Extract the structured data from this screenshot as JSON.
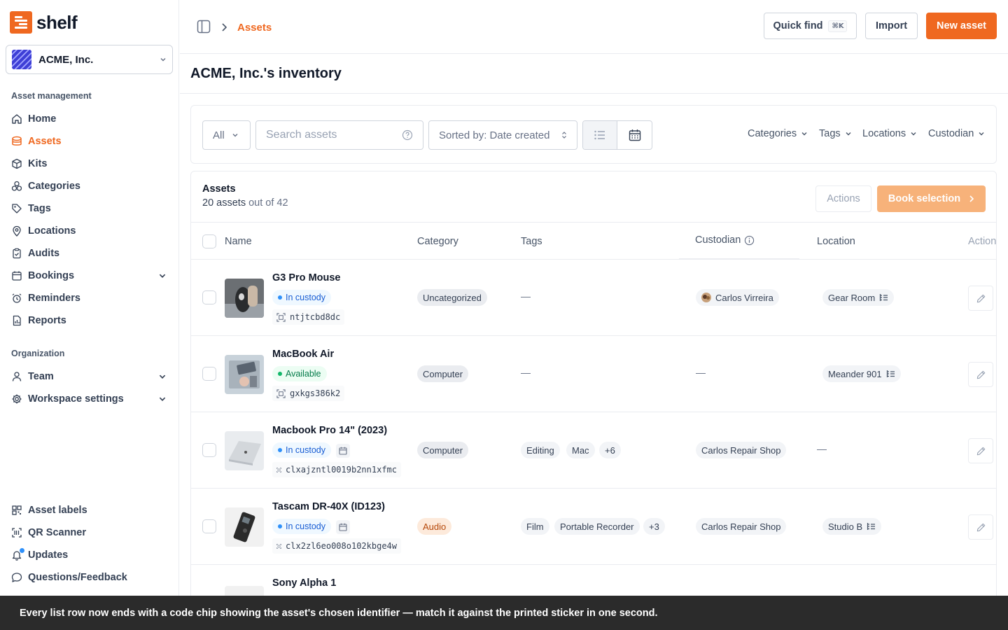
{
  "app": {
    "name": "shelf",
    "brand_color": "#ef6820"
  },
  "workspace": {
    "name": "ACME, Inc."
  },
  "sidebar": {
    "asset_section": "Asset management",
    "asset_items": [
      {
        "label": "Home",
        "icon": "home-icon"
      },
      {
        "label": "Assets",
        "icon": "assets-icon",
        "active": true
      },
      {
        "label": "Kits",
        "icon": "kits-icon"
      },
      {
        "label": "Categories",
        "icon": "categories-icon"
      },
      {
        "label": "Tags",
        "icon": "tag-icon"
      },
      {
        "label": "Locations",
        "icon": "location-pin-icon"
      },
      {
        "label": "Audits",
        "icon": "clipboard-icon"
      },
      {
        "label": "Bookings",
        "icon": "calendar-icon"
      },
      {
        "label": "Reminders",
        "icon": "alarm-icon"
      },
      {
        "label": "Reports",
        "icon": "report-icon"
      }
    ],
    "org_section": "Organization",
    "org_items": [
      {
        "label": "Team",
        "icon": "user-icon"
      },
      {
        "label": "Workspace settings",
        "icon": "gear-icon"
      }
    ],
    "bottom_items": [
      {
        "label": "Asset labels",
        "icon": "qr-icon"
      },
      {
        "label": "QR Scanner",
        "icon": "scanner-icon"
      },
      {
        "label": "Updates",
        "icon": "bell-icon"
      },
      {
        "label": "Questions/Feedback",
        "icon": "chat-icon"
      }
    ]
  },
  "header": {
    "breadcrumb": "Assets",
    "quick_find": "Quick find",
    "quick_find_kbd": "⌘K",
    "import": "Import",
    "new_asset": "New asset"
  },
  "page_title": "ACME, Inc.'s inventory",
  "filters": {
    "status": "All",
    "search_placeholder": "Search assets",
    "sort": "Sorted by: Date created",
    "dropdowns": [
      "Categories",
      "Tags",
      "Locations",
      "Custodian"
    ]
  },
  "table": {
    "title": "Assets",
    "count": "20 assets",
    "count_suffix": "out of 42",
    "actions": "Actions",
    "book_selection": "Book selection",
    "columns": [
      "Name",
      "Category",
      "Tags",
      "Custodian",
      "Location",
      "Actions"
    ],
    "rows": [
      {
        "name": "G3 Pro Mouse",
        "status": "In custody",
        "code": "ntjtcbd8dc",
        "category": "Uncategorized",
        "tags": [],
        "tags_empty": "—",
        "custodian": "Carlos Virreira",
        "location": "Gear Room"
      },
      {
        "name": "MacBook Air",
        "status": "Available",
        "code": "gxkgs386k2",
        "category": "Computer",
        "tags": [],
        "tags_empty": "—",
        "custodian": "",
        "custodian_empty": "—",
        "location": "Meander 901"
      },
      {
        "name": "Macbook Pro 14\" (2023)",
        "status": "In custody",
        "code": "clxajzntl0019b2nn1xfmc",
        "category": "Computer",
        "tags": [
          "Editing",
          "Mac"
        ],
        "tags_more": "+6",
        "custodian": "Carlos Repair Shop",
        "location": "",
        "location_empty": "—"
      },
      {
        "name": "Tascam DR-40X (ID123)",
        "status": "In custody",
        "code": "clx2zl6eo008o102kbge4w",
        "category": "Audio",
        "tags": [
          "Film",
          "Portable Recorder"
        ],
        "tags_more": "+3",
        "custodian": "Carlos Repair Shop",
        "location": "Studio B"
      },
      {
        "name": "Sony Alpha 1"
      }
    ]
  },
  "toast": "Every list row now ends with a code chip showing the asset's chosen identifier — match it against the printed sticker in one second."
}
